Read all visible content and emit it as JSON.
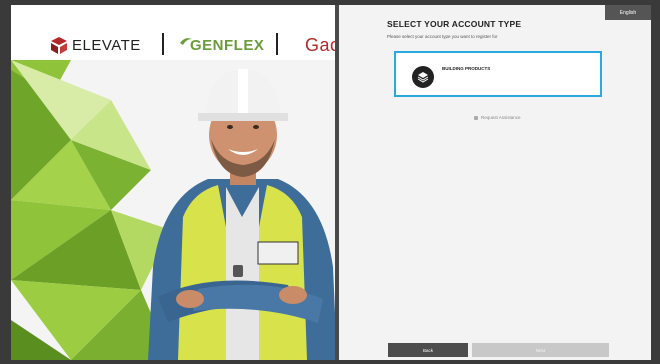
{
  "brands": {
    "elevate": "ELEVATE",
    "genflex": "GENFLEX",
    "gaco": "Gac"
  },
  "colors": {
    "elevate_red": "#b02a2a",
    "genflex_green": "#6a9d3a",
    "gaco_red": "#b02a2a",
    "selection_blue": "#29a9e0",
    "green_bg": "#8cbf3a"
  },
  "language": {
    "label": "English"
  },
  "form": {
    "title": "SELECT YOUR ACCOUNT TYPE",
    "subtitle": "Please select your account type you want to register for",
    "options": [
      {
        "label": "BUILDING PRODUCTS",
        "icon": "layers-icon",
        "selected": true
      }
    ],
    "assist_label": "Request Assistance"
  },
  "footer": {
    "back_label": "Back",
    "next_label": "Next"
  }
}
